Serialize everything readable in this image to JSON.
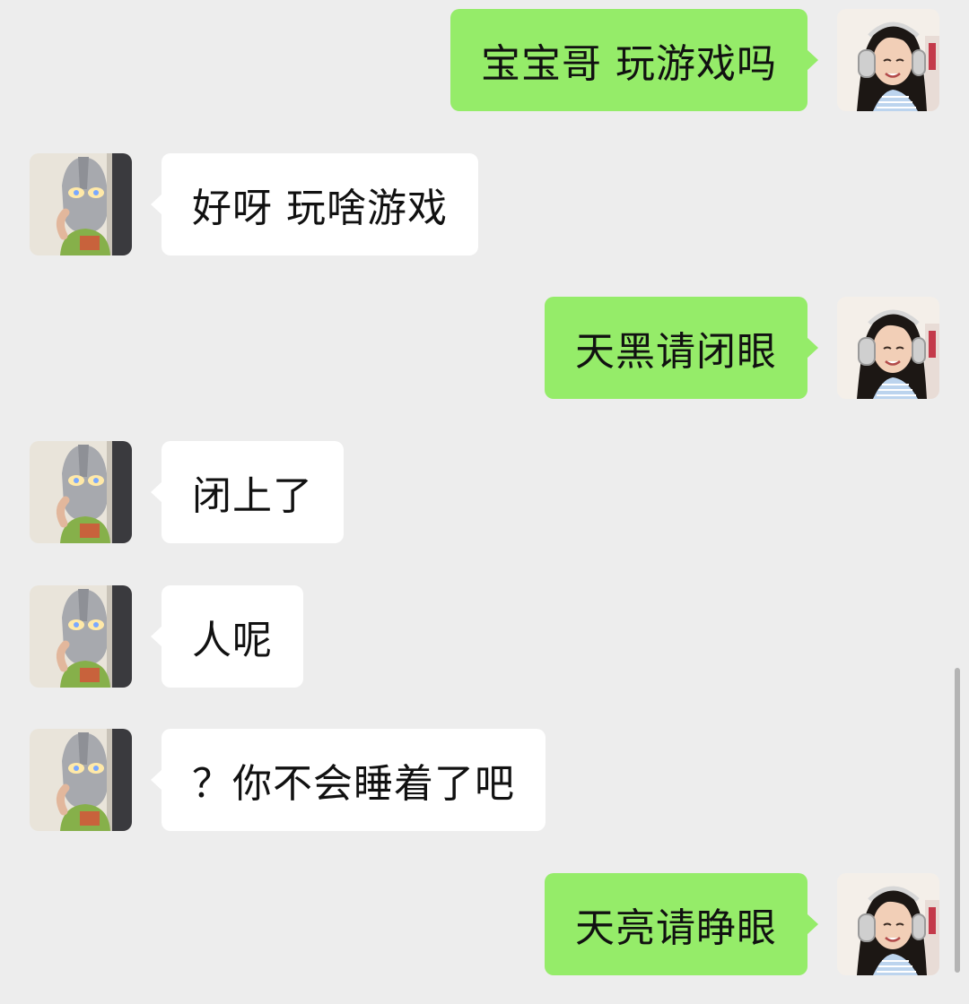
{
  "colors": {
    "background": "#ededed",
    "outgoing_bubble": "#95ec69",
    "incoming_bubble": "#ffffff",
    "text": "#111111"
  },
  "icons": {
    "self_avatar": "girl-with-headphones-avatar",
    "contact_avatar": "ultraman-mask-avatar"
  },
  "messages": [
    {
      "sender": "self",
      "text": "宝宝哥 玩游戏吗"
    },
    {
      "sender": "contact",
      "text": "好呀 玩啥游戏"
    },
    {
      "sender": "self",
      "text": "天黑请闭眼"
    },
    {
      "sender": "contact",
      "text": "闭上了"
    },
    {
      "sender": "contact",
      "text": "人呢"
    },
    {
      "sender": "contact",
      "text": "？你不会睡着了吧"
    },
    {
      "sender": "self",
      "text": "天亮请睁眼"
    }
  ]
}
